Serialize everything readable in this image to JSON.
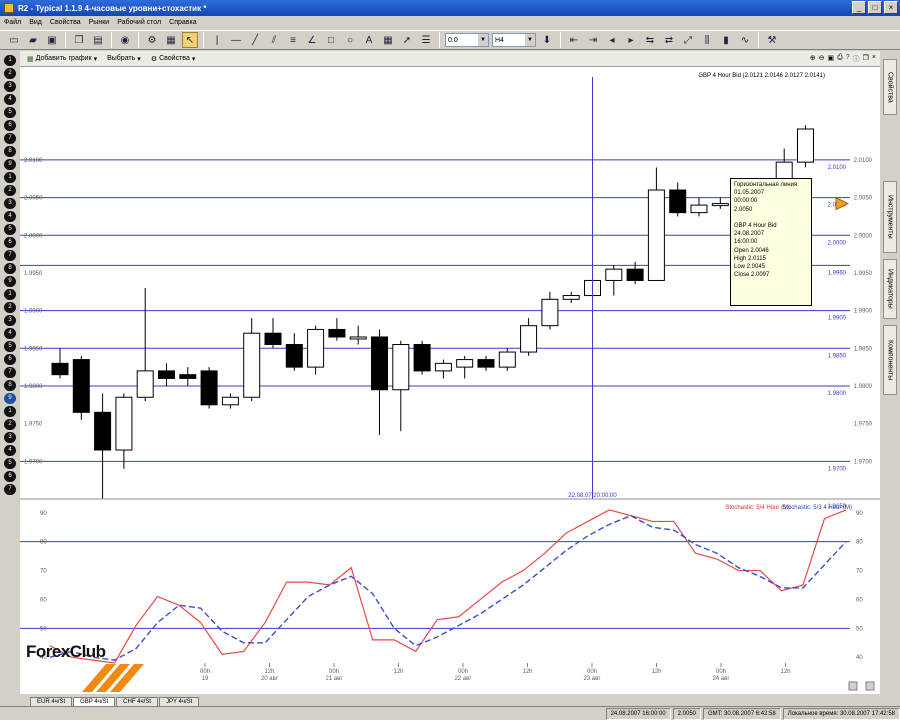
{
  "window": {
    "title": "R2 - Typical 1.1.9 4-часовые уровни+стохастик *"
  },
  "menu": [
    "Файл",
    "Вид",
    "Свойства",
    "Рынки",
    "Рабочий стол",
    "Справка"
  ],
  "toolbar": {
    "step_value": "0.0",
    "timeframe_value": "H4"
  },
  "chart_toolbar": {
    "add_chart": "Добавить график",
    "select": "Выбрать",
    "properties": "Свойства"
  },
  "chart_header": "GBP 4 Hour Bid (2.0121 2.0146 2.0127 2.0141)",
  "right_tabs": [
    "Свойства",
    "Инструменты",
    "Индикаторы",
    "Компоненты"
  ],
  "left_strip_count": 34,
  "chart_data": {
    "type": "candlestick",
    "title": "GBP 4 Hour Bid",
    "ylim": [
      1.965,
      2.021
    ],
    "y_ticks": [
      "2.0100",
      "2.0050",
      "2.0000",
      "1.9950",
      "1.9900",
      "1.9850",
      "1.9800",
      "1.9750",
      "1.9700"
    ],
    "hlines": [
      {
        "value": 2.01,
        "label": "2.0100"
      },
      {
        "value": 2.005,
        "label": "2.0050"
      },
      {
        "value": 2.0,
        "label": "2.0000"
      },
      {
        "value": 1.996,
        "label": "1.9960"
      },
      {
        "value": 1.99,
        "label": "1.9900"
      },
      {
        "value": 1.985,
        "label": "1.9850"
      },
      {
        "value": 1.98,
        "label": "1.9800"
      },
      {
        "value": 1.97,
        "label": "1.9700"
      },
      {
        "value": 1.965,
        "label": "1.9650"
      }
    ],
    "candles": [
      {
        "o": 1.983,
        "h": 1.985,
        "l": 1.981,
        "c": 1.9815
      },
      {
        "o": 1.9835,
        "h": 1.984,
        "l": 1.9755,
        "c": 1.9765
      },
      {
        "o": 1.9765,
        "h": 1.979,
        "l": 1.965,
        "c": 1.9715
      },
      {
        "o": 1.9715,
        "h": 1.979,
        "l": 1.969,
        "c": 1.9785
      },
      {
        "o": 1.9785,
        "h": 1.993,
        "l": 1.978,
        "c": 1.982
      },
      {
        "o": 1.982,
        "h": 1.983,
        "l": 1.98,
        "c": 1.981
      },
      {
        "o": 1.9815,
        "h": 1.9825,
        "l": 1.98,
        "c": 1.981
      },
      {
        "o": 1.982,
        "h": 1.9825,
        "l": 1.977,
        "c": 1.9775
      },
      {
        "o": 1.9775,
        "h": 1.979,
        "l": 1.977,
        "c": 1.9785
      },
      {
        "o": 1.9785,
        "h": 1.989,
        "l": 1.978,
        "c": 1.987
      },
      {
        "o": 1.987,
        "h": 1.989,
        "l": 1.985,
        "c": 1.9855
      },
      {
        "o": 1.9855,
        "h": 1.987,
        "l": 1.982,
        "c": 1.9825
      },
      {
        "o": 1.9825,
        "h": 1.988,
        "l": 1.9815,
        "c": 1.9875
      },
      {
        "o": 1.9875,
        "h": 1.989,
        "l": 1.986,
        "c": 1.9865
      },
      {
        "o": 1.9865,
        "h": 1.988,
        "l": 1.9855,
        "c": 1.9865
      },
      {
        "o": 1.9865,
        "h": 1.9875,
        "l": 1.9735,
        "c": 1.9795
      },
      {
        "o": 1.9795,
        "h": 1.986,
        "l": 1.974,
        "c": 1.9855
      },
      {
        "o": 1.9855,
        "h": 1.986,
        "l": 1.9815,
        "c": 1.982
      },
      {
        "o": 1.982,
        "h": 1.9835,
        "l": 1.981,
        "c": 1.983
      },
      {
        "o": 1.9825,
        "h": 1.984,
        "l": 1.981,
        "c": 1.9835
      },
      {
        "o": 1.9835,
        "h": 1.984,
        "l": 1.982,
        "c": 1.9825
      },
      {
        "o": 1.9825,
        "h": 1.985,
        "l": 1.982,
        "c": 1.9845
      },
      {
        "o": 1.9845,
        "h": 1.989,
        "l": 1.984,
        "c": 1.988
      },
      {
        "o": 1.988,
        "h": 1.9925,
        "l": 1.9875,
        "c": 1.9915
      },
      {
        "o": 1.9915,
        "h": 1.9925,
        "l": 1.991,
        "c": 1.992
      },
      {
        "o": 1.992,
        "h": 1.995,
        "l": 1.9915,
        "c": 1.994
      },
      {
        "o": 1.994,
        "h": 1.996,
        "l": 1.992,
        "c": 1.9955
      },
      {
        "o": 1.9955,
        "h": 1.9965,
        "l": 1.9935,
        "c": 1.994
      },
      {
        "o": 1.994,
        "h": 2.009,
        "l": 1.994,
        "c": 2.006
      },
      {
        "o": 2.006,
        "h": 2.007,
        "l": 2.0025,
        "c": 2.003
      },
      {
        "o": 2.003,
        "h": 2.005,
        "l": 2.0025,
        "c": 2.004
      },
      {
        "o": 2.004,
        "h": 2.005,
        "l": 2.0035,
        "c": 2.0042
      },
      {
        "o": 2.0043,
        "h": 2.0048,
        "l": 2.0028,
        "c": 2.003
      },
      {
        "o": 2.003,
        "h": 2.005,
        "l": 2.0025,
        "c": 2.0045
      },
      {
        "o": 2.0046,
        "h": 2.0115,
        "l": 2.0045,
        "c": 2.0097
      },
      {
        "o": 2.0097,
        "h": 2.0146,
        "l": 2.009,
        "c": 2.0141
      }
    ],
    "crosshair": {
      "candle_index": 25,
      "label": "22.08.07 20:00:00"
    },
    "stochastic": {
      "legend": [
        "Stochastic: 5/4 Hour (M)",
        "Stochastic: 5/3 4 Hour (M)"
      ],
      "ylim": [
        38,
        92
      ],
      "y_ticks": [
        "90",
        "80",
        "70",
        "60",
        "50",
        "40"
      ],
      "hlines": [
        80,
        50
      ],
      "k": [
        44,
        40,
        39,
        38,
        51,
        61,
        58,
        52,
        41,
        42,
        52,
        66,
        66,
        65,
        71,
        46,
        46,
        42,
        53,
        54,
        60,
        66,
        70,
        76,
        83,
        87,
        91,
        89,
        87,
        87,
        76,
        74,
        70,
        70,
        63,
        65,
        88,
        91
      ],
      "d": [
        40,
        42,
        40,
        39,
        43,
        52,
        58,
        57,
        49,
        45,
        45,
        53,
        61,
        65,
        68,
        62,
        50,
        44,
        47,
        51,
        55,
        60,
        65,
        71,
        77,
        82,
        86,
        89,
        85,
        84,
        79,
        76,
        71,
        68,
        64,
        64,
        72,
        80
      ]
    },
    "time_labels": [
      {
        "t": "00h",
        "d": "19"
      },
      {
        "t": "12h",
        "d": "20 авг"
      },
      {
        "t": "00h",
        "d": "21 авг"
      },
      {
        "t": "12h",
        "d": ""
      },
      {
        "t": "00h",
        "d": "22 авг"
      },
      {
        "t": "12h",
        "d": ""
      },
      {
        "t": "00h",
        "d": "23 авг"
      },
      {
        "t": "12h",
        "d": ""
      },
      {
        "t": "00h",
        "d": "24 авг"
      },
      {
        "t": "12h",
        "d": ""
      }
    ]
  },
  "tooltip": {
    "lines": [
      "Горизонтальная линия",
      "01.05.2007",
      "00:00:00",
      "2.0050",
      "",
      "GBP 4 Hour Bid",
      "24.08.2007",
      "16:00:00",
      "Open 2.0046",
      "High 2.0115",
      "Low 2.0045",
      "Close 2.0097"
    ]
  },
  "logo": {
    "text": "ForexClub"
  },
  "tabs": [
    "EUR 4ч/St",
    "GBP 4ч/St",
    "CHF 4ч/St",
    "JPY 4ч/St"
  ],
  "status": [
    "24.08.2007 16:00:00",
    "2.0050",
    "GMT: 30.08.2007 6:42:58",
    "Локальное время: 30.08.2007 17:42:58"
  ],
  "colors": {
    "grid": "#3a3ad0",
    "k_line": "#e84848",
    "d_line": "#3a50c8",
    "tooltip_bg": "#ffffe1",
    "marker": "#f0a020"
  }
}
